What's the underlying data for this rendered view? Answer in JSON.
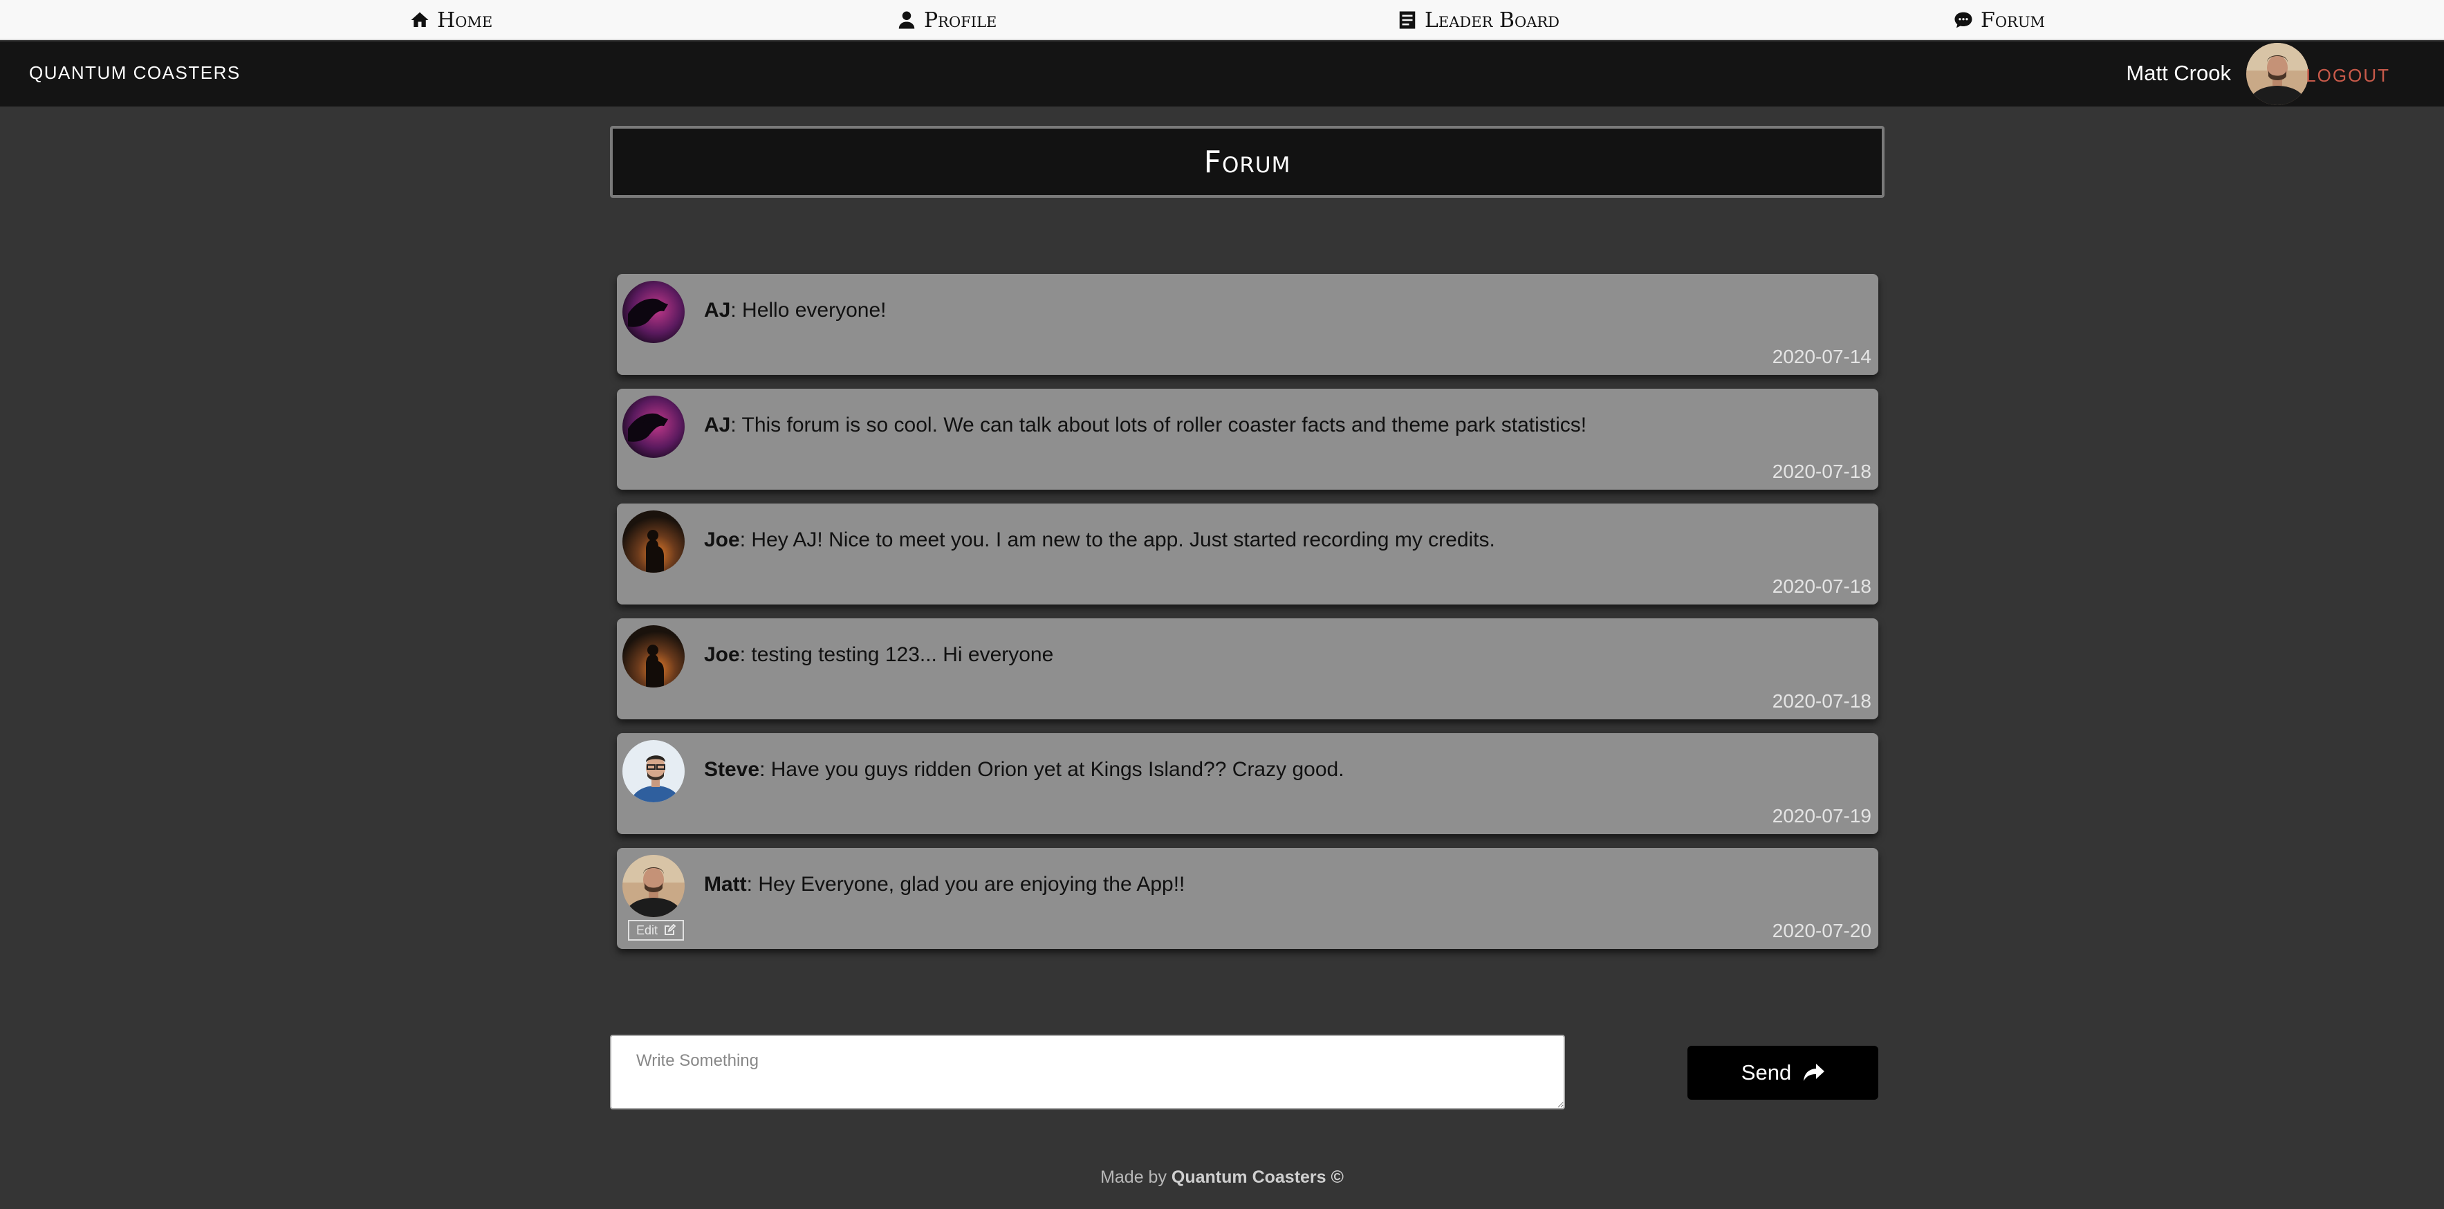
{
  "topnav": {
    "home": "Home",
    "profile": "Profile",
    "leaderboard": "Leader Board",
    "forum": "Forum"
  },
  "header": {
    "brand": "QUANTUM COASTERS",
    "username": "Matt Crook",
    "logout": "LOGOUT"
  },
  "page": {
    "title": "Forum"
  },
  "messages": [
    {
      "author": "AJ",
      "text": ": Hello everyone!",
      "date": "2020-07-14",
      "avatar": "aj"
    },
    {
      "author": "AJ",
      "text": ": This forum is so cool. We can talk about lots of roller coaster facts and theme park statistics!",
      "date": "2020-07-18",
      "avatar": "aj"
    },
    {
      "author": "Joe",
      "text": ": Hey AJ! Nice to meet you. I am new to the app. Just started recording my credits.",
      "date": "2020-07-18",
      "avatar": "joe"
    },
    {
      "author": "Joe",
      "text": ": testing testing 123... Hi everyone",
      "date": "2020-07-18",
      "avatar": "joe"
    },
    {
      "author": "Steve",
      "text": ": Have you guys ridden Orion yet at Kings Island?? Crazy good.",
      "date": "2020-07-19",
      "avatar": "steve"
    },
    {
      "author": "Matt",
      "text": ": Hey Everyone, glad you are enjoying the App!!",
      "date": "2020-07-20",
      "avatar": "matt",
      "edit_label": "Edit"
    }
  ],
  "compose": {
    "placeholder": "Write Something",
    "value": "",
    "send_label": "Send"
  },
  "footer": {
    "prefix": "Made by ",
    "brand": "Quantum Coasters ©"
  },
  "icons": {
    "home": "home-icon",
    "profile": "user-icon",
    "leaderboard": "list-icon",
    "forum": "chat-bubble-icon",
    "send": "share-arrow-icon",
    "edit": "edit-square-icon"
  },
  "colors": {
    "background": "#353535",
    "header": "#141414",
    "message_card": "#8f8f8f",
    "logout": "#c85a4a"
  }
}
